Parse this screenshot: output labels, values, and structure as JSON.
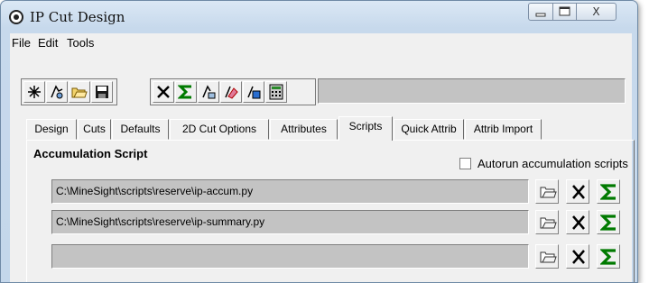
{
  "window": {
    "title": "IP Cut Design",
    "minimize_glyph": "–",
    "maximize_glyph": "□",
    "close_glyph": "X"
  },
  "menu": [
    "File",
    "Edit",
    "Tools"
  ],
  "toolbar": {
    "icons": [
      "asterisk-icon",
      "pick-icon",
      "open-folder-icon",
      "save-icon",
      "delete-icon",
      "sigma-icon",
      "select-icon",
      "eraser-icon",
      "copy-icon",
      "calculator-icon"
    ],
    "status_text": ""
  },
  "tabs": [
    "Design",
    "Cuts",
    "Defaults",
    "2D Cut Options",
    "Attributes",
    "Scripts",
    "Quick Attrib",
    "Attrib Import"
  ],
  "active_tab": "Scripts",
  "section": {
    "title": "Accumulation Script",
    "autorun_label": "Autorun accumulation scripts",
    "autorun_checked": false
  },
  "scripts": [
    {
      "path": "C:\\MineSight\\scripts\\reserve\\ip-accum.py"
    },
    {
      "path": "C:\\MineSight\\scripts\\reserve\\ip-summary.py"
    },
    {
      "path": ""
    }
  ],
  "colors": {
    "field_bg": "#c3c3c3",
    "sigma_green": "#007a00",
    "window_frame": "#c4d7eb"
  }
}
